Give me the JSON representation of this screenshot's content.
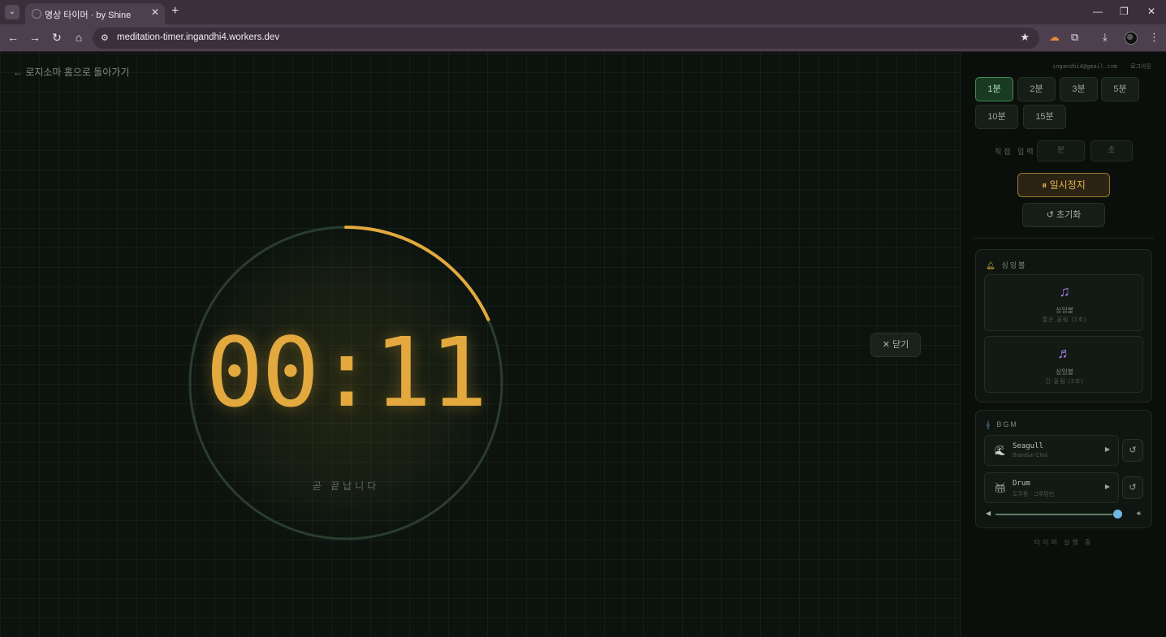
{
  "browser": {
    "tab_title": "명상 타이머 · by Shine",
    "url": "meditation-timer.ingandhi4.workers.dev"
  },
  "page": {
    "back_link": "← 로지소마 홈으로 돌아가기",
    "timer": {
      "display": "00:11",
      "subtitle": "곧 끝납니다",
      "progress_remaining_fraction": 0.183,
      "ring_color": "#e3a93e"
    },
    "close_button": "✕ 닫기"
  },
  "sidebar": {
    "user_email": "ingandhi4@gmail.com",
    "logout": "로그아웃",
    "presets": [
      "1분",
      "2분",
      "3분",
      "5분",
      "10분",
      "15분"
    ],
    "active_preset": "1분",
    "direct_input_label": "직접 입력",
    "minutes_placeholder": "분",
    "seconds_placeholder": "초",
    "pause_button": "⏸ 일시정지",
    "reset_button": "↺ 초기화",
    "singing_bowl": {
      "title": "싱잉볼",
      "cards": [
        {
          "label": "싱잉볼",
          "sub": "짧은 울림 (2초)"
        },
        {
          "label": "싱잉볼",
          "sub": "긴 울림 (3초)"
        }
      ]
    },
    "bgm": {
      "title": "BGM",
      "tracks": [
        {
          "name": "Seagull",
          "artist": "Brandon Choi"
        },
        {
          "name": "Drum",
          "artist": "도무동 · 그루밍빈"
        }
      ],
      "volume": 0.95
    },
    "footer": "타이머 실행 중"
  }
}
